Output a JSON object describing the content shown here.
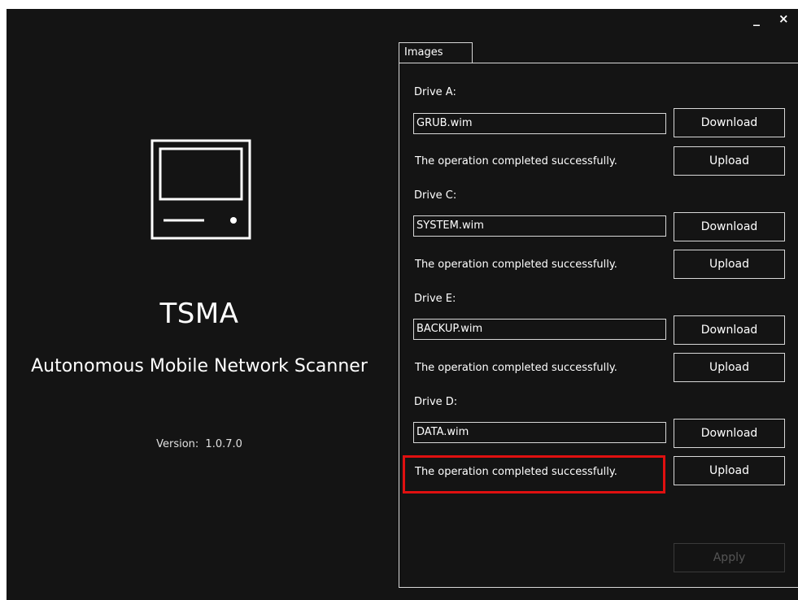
{
  "window": {
    "minimize_label": "_",
    "close_label": "×"
  },
  "left_panel": {
    "icon": "monitor-icon",
    "title": "TSMA",
    "subtitle": "Autonomous Mobile Network Scanner",
    "version_label": "Version:",
    "version_value": "1.0.7.0"
  },
  "tabs": [
    {
      "label": "Images",
      "selected": true
    }
  ],
  "drives": [
    {
      "label": "Drive A:",
      "file": "GRUB.wim",
      "status": "The operation completed successfully.",
      "download_label": "Download",
      "upload_label": "Upload"
    },
    {
      "label": "Drive C:",
      "file": "SYSTEM.wim",
      "status": "The operation completed successfully.",
      "download_label": "Download",
      "upload_label": "Upload"
    },
    {
      "label": "Drive E:",
      "file": "BACKUP.wim",
      "status": "The operation completed successfully.",
      "download_label": "Download",
      "upload_label": "Upload"
    },
    {
      "label": "Drive D:",
      "file": "DATA.wim",
      "status": "The operation completed successfully.",
      "download_label": "Download",
      "upload_label": "Upload"
    }
  ],
  "apply_label": "Apply",
  "colors": {
    "background": "#141414",
    "foreground": "#ffffff",
    "highlight": "#e01010",
    "disabled": "#555555"
  }
}
